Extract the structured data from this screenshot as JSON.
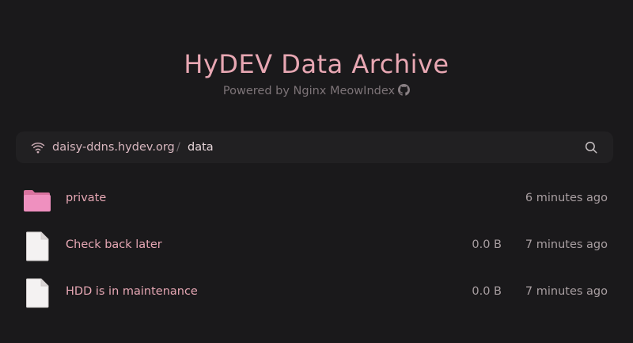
{
  "header": {
    "title": "HyDEV Data Archive",
    "subtitle": "Powered by Nginx MeowIndex"
  },
  "breadcrumb": {
    "host": "daisy-ddns.hydev.org",
    "separator": "/",
    "current": "data"
  },
  "files": [
    {
      "name": "private",
      "type": "folder",
      "size": "",
      "modified": "6 minutes ago"
    },
    {
      "name": "Check back later",
      "type": "file",
      "size": "0.0 B",
      "modified": "7 minutes ago"
    },
    {
      "name": "HDD is in maintenance",
      "type": "file",
      "size": "0.0 B",
      "modified": "7 minutes ago"
    }
  ],
  "icons": {
    "header_link": "github-icon",
    "host": "wifi-icon",
    "search": "search-icon",
    "folder": "folder-icon",
    "file": "file-icon"
  },
  "colors": {
    "background": "#1a191b",
    "accent": "#e8a7b3",
    "folder": "#e98bb9",
    "file": "#f3f1f1"
  }
}
